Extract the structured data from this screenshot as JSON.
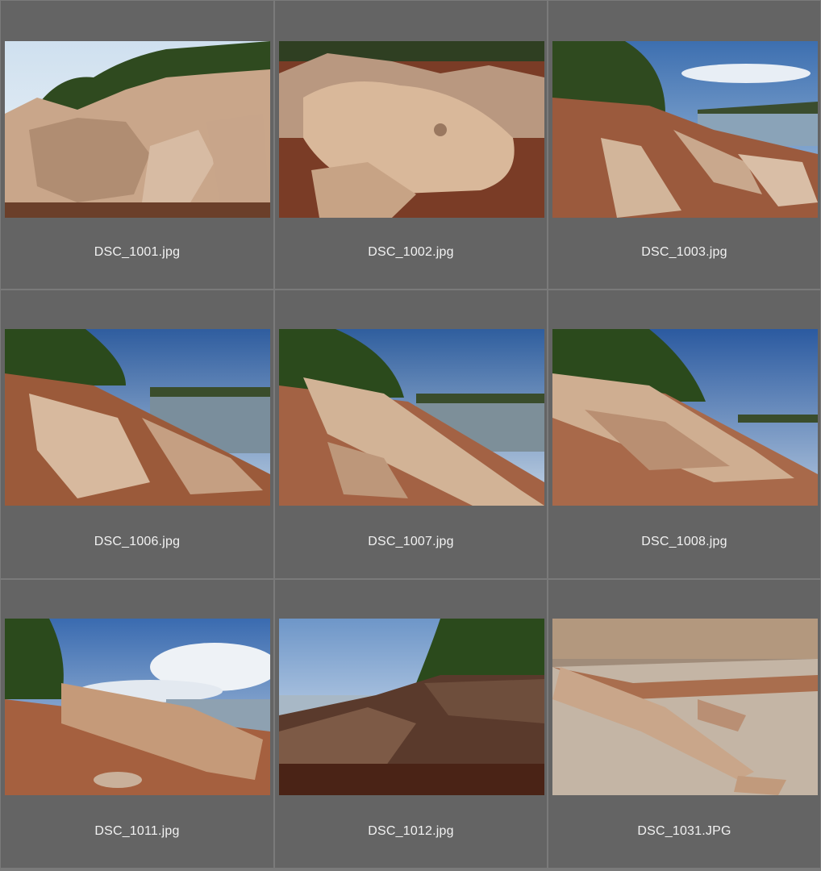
{
  "files": [
    {
      "name": "DSC_1001.jpg",
      "scene": "boulders-trees"
    },
    {
      "name": "DSC_1002.jpg",
      "scene": "boulder-closeup"
    },
    {
      "name": "DSC_1003.jpg",
      "scene": "shore-rocks-water"
    },
    {
      "name": "DSC_1006.jpg",
      "scene": "slanted-rocks-lake"
    },
    {
      "name": "DSC_1007.jpg",
      "scene": "slanted-rocks-lake-2"
    },
    {
      "name": "DSC_1008.jpg",
      "scene": "stacked-slabs-lake"
    },
    {
      "name": "DSC_1011.jpg",
      "scene": "log-rock-clouds"
    },
    {
      "name": "DSC_1012.jpg",
      "scene": "dark-rocks-haze"
    },
    {
      "name": "DSC_1031.JPG",
      "scene": "gravel-slabs"
    }
  ]
}
